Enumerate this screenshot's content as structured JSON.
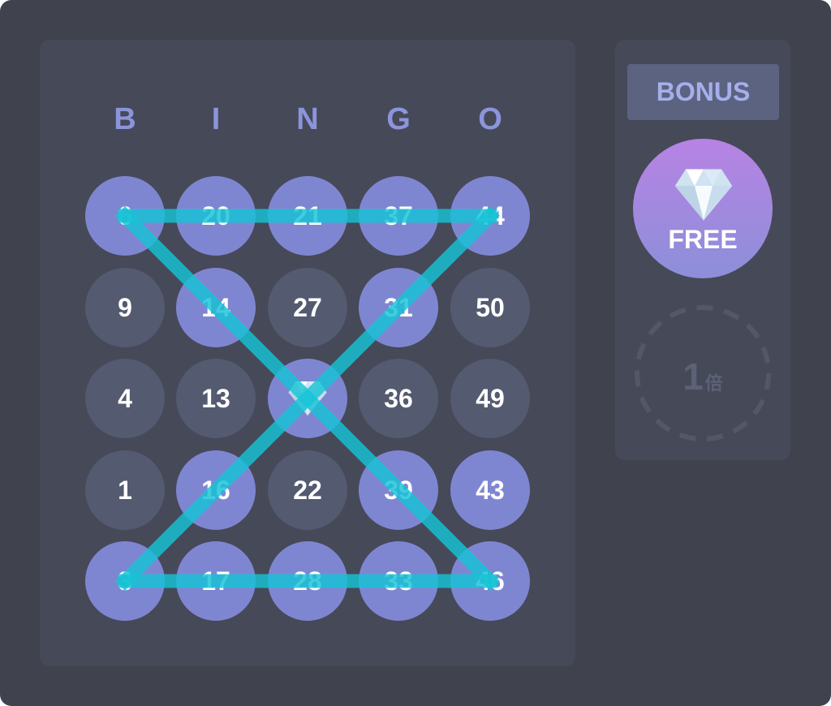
{
  "card": {
    "header": [
      "B",
      "I",
      "N",
      "G",
      "O"
    ],
    "rows": [
      [
        {
          "value": "6",
          "marked": true
        },
        {
          "value": "20",
          "marked": true
        },
        {
          "value": "21",
          "marked": true
        },
        {
          "value": "37",
          "marked": true
        },
        {
          "value": "44",
          "marked": true
        }
      ],
      [
        {
          "value": "9",
          "marked": false
        },
        {
          "value": "14",
          "marked": true
        },
        {
          "value": "27",
          "marked": false
        },
        {
          "value": "31",
          "marked": true
        },
        {
          "value": "50",
          "marked": false
        }
      ],
      [
        {
          "value": "4",
          "marked": false
        },
        {
          "value": "13",
          "marked": false
        },
        {
          "value": "",
          "marked": true,
          "icon": "diamond-icon"
        },
        {
          "value": "36",
          "marked": false
        },
        {
          "value": "49",
          "marked": false
        }
      ],
      [
        {
          "value": "1",
          "marked": false
        },
        {
          "value": "16",
          "marked": true
        },
        {
          "value": "22",
          "marked": false
        },
        {
          "value": "39",
          "marked": true
        },
        {
          "value": "43",
          "marked": true
        }
      ],
      [
        {
          "value": "3",
          "marked": true
        },
        {
          "value": "17",
          "marked": true
        },
        {
          "value": "28",
          "marked": true
        },
        {
          "value": "33",
          "marked": true
        },
        {
          "value": "46",
          "marked": true
        }
      ]
    ],
    "win_pattern": "hourglass",
    "colors": {
      "marked": "#7f86d1",
      "unmarked": "#545a70",
      "line": "#16c4d6",
      "header": "#8c94db"
    }
  },
  "bonus": {
    "label": "BONUS",
    "free_label": "FREE",
    "free_icon": "diamond-icon",
    "multiplier_value": "1",
    "multiplier_unit": "倍"
  }
}
